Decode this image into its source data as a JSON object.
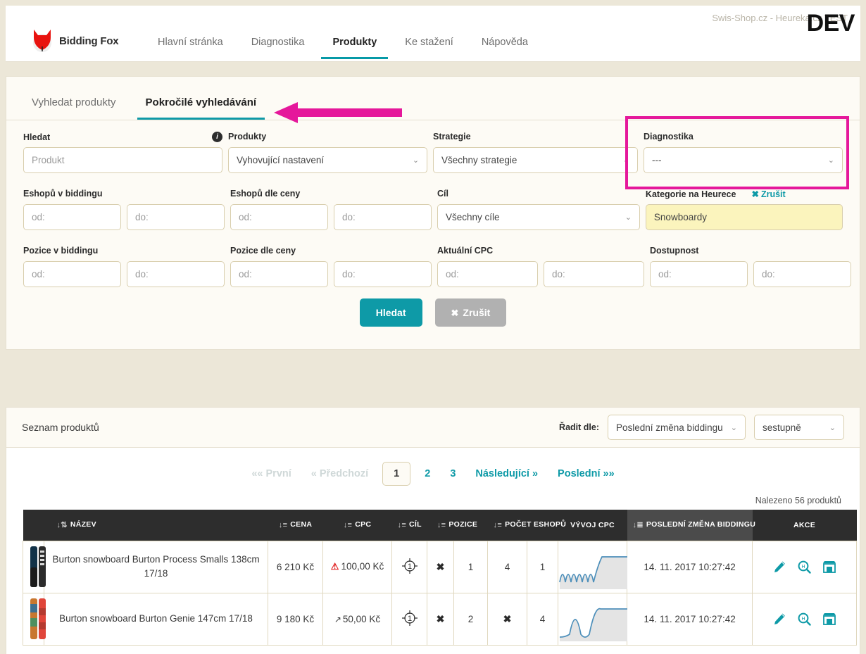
{
  "header": {
    "env_note": "Swis-Shop.cz - Heureka.cz TEST",
    "dev_badge": "DEV",
    "brand": "Bidding Fox",
    "nav": [
      {
        "label": "Hlavní stránka",
        "active": false
      },
      {
        "label": "Diagnostika",
        "active": false
      },
      {
        "label": "Produkty",
        "active": true
      },
      {
        "label": "Ke stažení",
        "active": false
      },
      {
        "label": "Nápověda",
        "active": false
      }
    ]
  },
  "tabs": [
    {
      "label": "Vyhledat produkty",
      "active": false
    },
    {
      "label": "Pokročilé vyhledávání",
      "active": true
    }
  ],
  "form": {
    "hledat": {
      "label": "Hledat",
      "placeholder": "Produkt",
      "value": ""
    },
    "produkty": {
      "label": "Produkty",
      "value": "Vyhovující nastavení"
    },
    "strategie": {
      "label": "Strategie",
      "value": "Všechny strategie"
    },
    "diagnostika": {
      "label": "Diagnostika",
      "value": "---"
    },
    "eshopu_v_biddingu": {
      "label": "Eshopů v biddingu",
      "od": "od:",
      "do": "do:"
    },
    "eshopu_dle_ceny": {
      "label": "Eshopů dle ceny",
      "od": "od:",
      "do": "do:"
    },
    "cil": {
      "label": "Cíl",
      "value": "Všechny cíle"
    },
    "kategorie": {
      "label": "Kategorie na Heurece",
      "cancel": "Zrušit",
      "value": "Snowboardy"
    },
    "pozice_v_biddingu": {
      "label": "Pozice v biddingu",
      "od": "od:",
      "do": "do:"
    },
    "pozice_dle_ceny": {
      "label": "Pozice dle ceny",
      "od": "od:",
      "do": "do:"
    },
    "aktualni_cpc": {
      "label": "Aktuální CPC",
      "od": "od:",
      "do": "do:"
    },
    "dostupnost": {
      "label": "Dostupnost",
      "od": "od:",
      "do": "do:"
    },
    "submit": "Hledat",
    "reset": "Zrušit"
  },
  "list": {
    "title": "Seznam produktů",
    "sort_label": "Řadit dle:",
    "sort_field": "Poslední změna biddingu",
    "sort_dir": "sestupně",
    "found": "Nalezeno 56 produktů",
    "pagination": {
      "first": "«« První",
      "prev": "« Předchozí",
      "pages": [
        "1",
        "2",
        "3"
      ],
      "current": "1",
      "next": "Následující »",
      "last": "Poslední »»"
    },
    "columns": [
      {
        "key": "nazev",
        "label": "NÁZEV",
        "sortable": true,
        "sorted": false
      },
      {
        "key": "cena",
        "label": "CENA",
        "sortable": true,
        "sorted": false
      },
      {
        "key": "cpc",
        "label": "CPC",
        "sortable": true,
        "sorted": false
      },
      {
        "key": "cil",
        "label": "CÍL",
        "sortable": true,
        "sorted": false
      },
      {
        "key": "pozice",
        "label": "POZICE",
        "sortable": true,
        "sorted": false
      },
      {
        "key": "pocet_eshopu",
        "label": "POČET ESHOPŮ",
        "sortable": true,
        "sorted": false
      },
      {
        "key": "vyvoj_cpc",
        "label": "VÝVOJ CPC",
        "sortable": false,
        "sorted": false
      },
      {
        "key": "posledni_zmena",
        "label": "POSLEDNÍ ZMĚNA BIDDINGU",
        "sortable": true,
        "sorted": true
      },
      {
        "key": "akce",
        "label": "AKCE",
        "sortable": false,
        "sorted": false
      }
    ],
    "rows": [
      {
        "name": "Burton snowboard Burton Process Smalls 138cm 17/18",
        "price": "6 210 Kč",
        "cpc": "100,00 Kč",
        "cpc_icon": "warning-triangle",
        "cil": "1",
        "pozice_a": "✖",
        "pozice_b": "1",
        "eshopu_a": "4",
        "eshopu_b": "1",
        "date": "14. 11. 2017 10:27:42"
      },
      {
        "name": "Burton snowboard Burton Genie 147cm 17/18",
        "price": "9 180 Kč",
        "cpc": "50,00 Kč",
        "cpc_icon": "arrow-up-right",
        "cil": "1",
        "pozice_a": "✖",
        "pozice_b": "2",
        "eshopu_a": "✖",
        "eshopu_b": "4",
        "date": "14. 11. 2017 10:27:42"
      }
    ]
  },
  "colors": {
    "accent": "#0e9aa7",
    "highlight": "#e5189b",
    "page_bg": "#ece7d8",
    "panel_bg": "#fdfbf5",
    "header_row": "#2d2d2d",
    "warning": "#e02020",
    "field_border": "#d9cfae",
    "cat_value_bg": "#fbf4bd"
  }
}
